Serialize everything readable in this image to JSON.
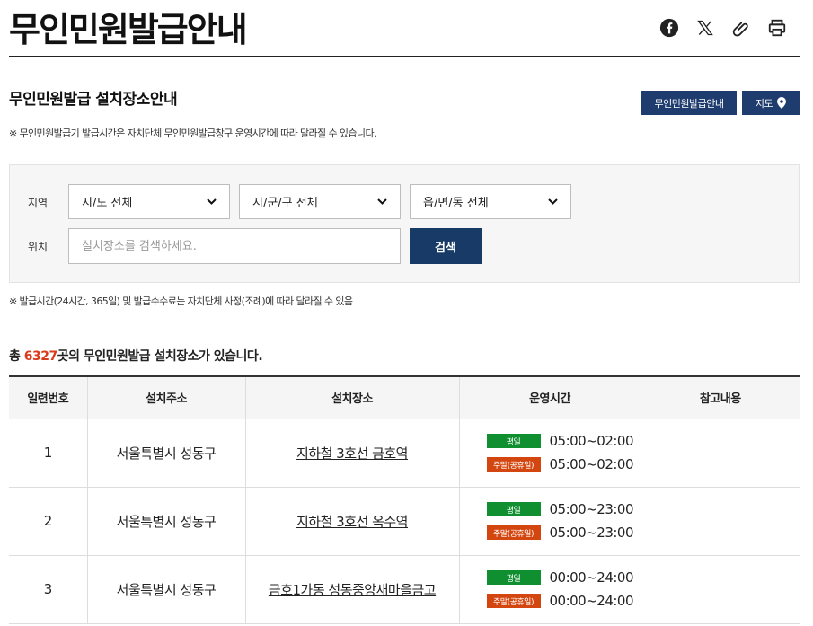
{
  "page": {
    "title": "무인민원발급안내"
  },
  "share": [
    {
      "name": "facebook-icon"
    },
    {
      "name": "x-icon"
    },
    {
      "name": "link-icon"
    },
    {
      "name": "print-icon"
    }
  ],
  "section": {
    "title": "무인민원발급 설치장소안내",
    "guide_button": "무인민원발급안내",
    "map_button": "지도",
    "notice": "※ 무인민원발급기 발급시간은 자치단체 무인민원발급창구 운영시간에 따라 달라질 수 있습니다."
  },
  "search": {
    "region_label": "지역",
    "location_label": "위치",
    "sido": "시/도 전체",
    "sigungu": "시/군/구 전체",
    "eupmyeondong": "읍/면/동 전체",
    "placeholder": "설치장소를 검색하세요.",
    "button": "검색"
  },
  "notice2": "※ 발급시간(24시간, 365일) 및 발급수수료는 자치단체 사정(조례)에 따라 달라질 수 있음",
  "total": {
    "prefix": "총 ",
    "count": "6327",
    "suffix": "곳의 무인민원발급 설치장소가 있습니다."
  },
  "table": {
    "headers": [
      "일련번호",
      "설치주소",
      "설치장소",
      "운영시간",
      "참고내용"
    ],
    "weekday_label": "평일",
    "holiday_label": "주말(공휴일)",
    "rows": [
      {
        "no": "1",
        "address": "서울특별시 성동구",
        "place": "지하철 3호선 금호역",
        "weekday": "05:00~02:00",
        "holiday": "05:00~02:00",
        "note": ""
      },
      {
        "no": "2",
        "address": "서울특별시 성동구",
        "place": "지하철 3호선 옥수역",
        "weekday": "05:00~23:00",
        "holiday": "05:00~23:00",
        "note": ""
      },
      {
        "no": "3",
        "address": "서울특별시 성동구",
        "place": "금호1가동 성동중앙새마을금고",
        "weekday": "00:00~24:00",
        "holiday": "00:00~24:00",
        "note": ""
      }
    ]
  },
  "colors": {
    "navy": "#1f3c6e",
    "weekday": "#0f8f2f",
    "holiday": "#d4460f",
    "count": "#d93b1b"
  }
}
